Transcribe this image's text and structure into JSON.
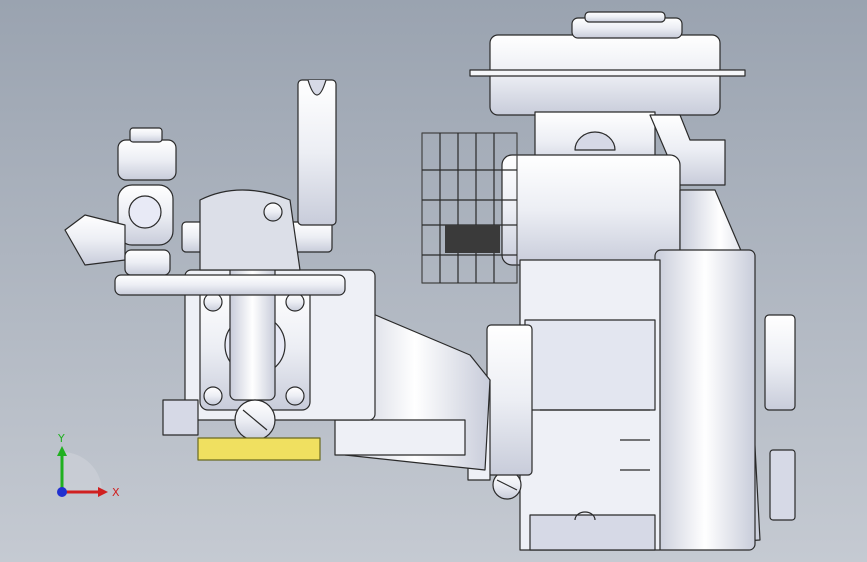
{
  "viewport": {
    "background_top": "#9aa3b0",
    "background_bottom": "#c5cad2"
  },
  "model": {
    "name_icon": "pressure-washer-pump-engine-model",
    "body_color": "#f4f5f8",
    "shade_color": "#d6d9e6",
    "edge_color": "#2a2a2a",
    "base_plate_color": "#f0e060"
  },
  "triad": {
    "x_label": "X",
    "y_label": "Y",
    "x_color": "#d02020",
    "y_color": "#20b020",
    "z_color": "#2030d0"
  }
}
